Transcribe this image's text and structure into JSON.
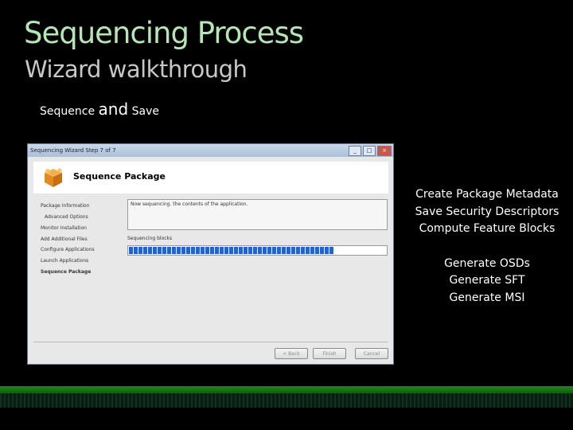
{
  "slide": {
    "title": "Sequencing Process",
    "subtitle": "Wizard walkthrough",
    "caption_pre": "Sequence ",
    "caption_and": "and",
    "caption_post": " Save",
    "bullets_group1": [
      "Create Package Metadata",
      "Save Security Descriptors",
      "Compute Feature Blocks"
    ],
    "bullets_group2": [
      "Generate OSDs",
      "Generate SFT",
      "Generate MSI"
    ],
    "colors": {
      "title": "#b5e6b5",
      "accent_bar": "#1f8a1f"
    }
  },
  "window": {
    "title": "Sequencing Wizard Step 7 of 7",
    "controls": {
      "minimize": "_",
      "maximize": "□",
      "close": "×"
    },
    "header_title": "Sequence Package",
    "nav_items": [
      "Package Information",
      "Advanced Options",
      "Monitor Installation",
      "Add Additional Files",
      "Configure Applications",
      "Launch Applications",
      "Sequence Package"
    ],
    "status_text": "Now sequencing. the contents of the application.",
    "progress_label": "Sequencing blocks",
    "progress_fraction": 0.8,
    "buttons": {
      "back": "< Back",
      "finish": "Finish",
      "cancel": "Cancel"
    }
  }
}
